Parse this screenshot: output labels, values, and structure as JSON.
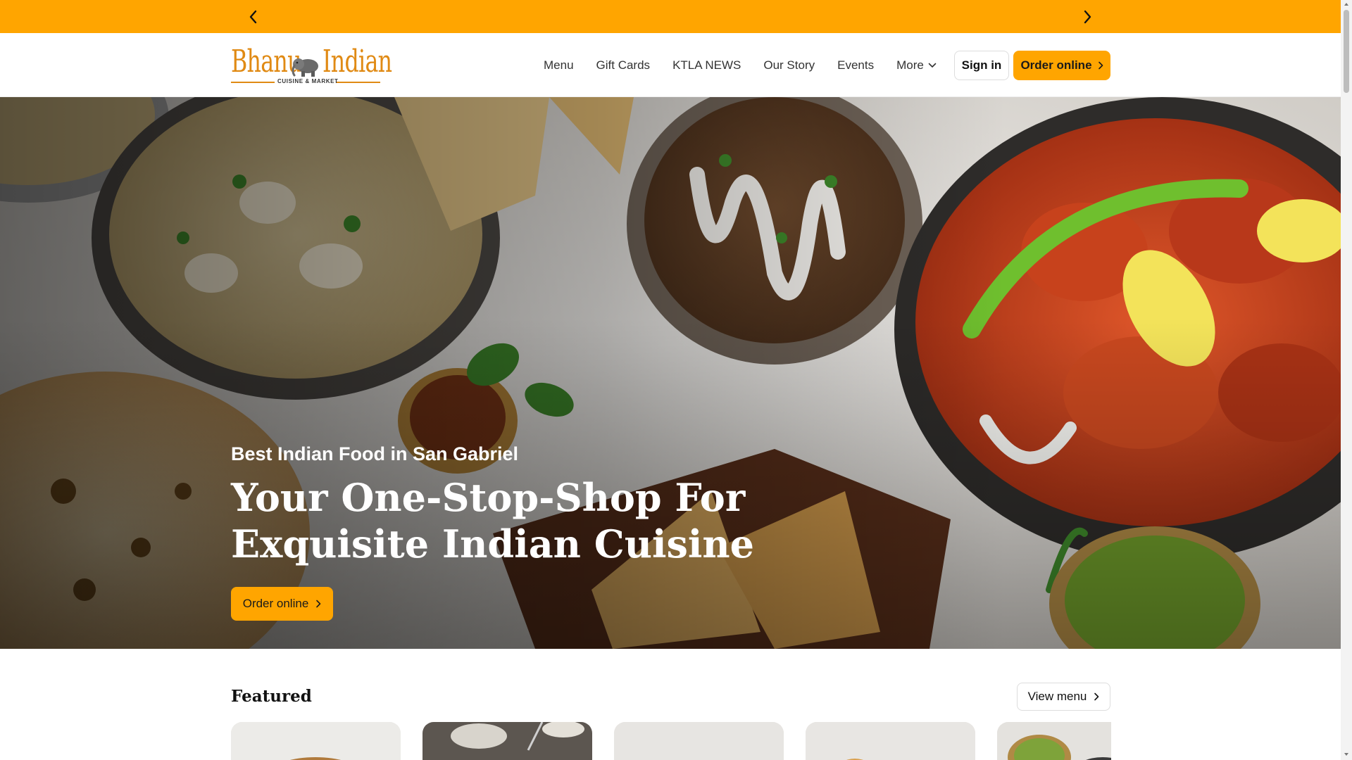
{
  "announcement": {
    "prev_icon": "chevron-left-icon",
    "next_icon": "chevron-right-icon",
    "color": "#ffa500"
  },
  "brand": {
    "name_part1": "Bhanu",
    "name_part2": "Indian",
    "tagline": "CUISINE & MARKET",
    "accent": "#e08a14"
  },
  "nav": {
    "items": [
      "Menu",
      "Gift Cards",
      "KTLA NEWS",
      "Our Story",
      "Events",
      "More"
    ],
    "more_icon": "chevron-down-icon",
    "sign_in": "Sign in",
    "order_online": "Order online"
  },
  "hero": {
    "eyebrow": "Best Indian Food in San Gabriel",
    "headline": "Your One-Stop-Shop For Exquisite Indian Cuisine",
    "cta": "Order online"
  },
  "featured": {
    "title": "Featured",
    "view_menu": "View menu"
  },
  "colors": {
    "primary": "#ffa500",
    "text": "#222222"
  }
}
